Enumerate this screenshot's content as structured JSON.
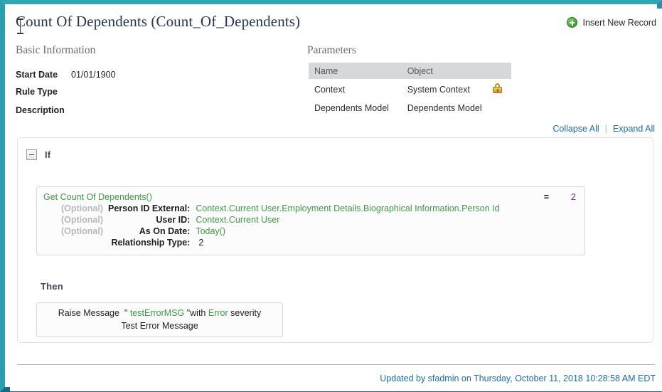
{
  "window": {
    "border_color": "#2aa0ae",
    "border_color_bottom": "#146b85"
  },
  "header": {
    "title": "Count Of Dependents (Count_Of_Dependents)",
    "insert_new_record_label": "Insert New Record",
    "insert_icon": "plus-circle-icon"
  },
  "basic_information": {
    "heading": "Basic Information",
    "fields": [
      {
        "label": "Start Date",
        "value": "01/01/1900"
      },
      {
        "label": "Rule Type",
        "value": ""
      },
      {
        "label": "Description",
        "value": ""
      }
    ]
  },
  "parameters": {
    "heading": "Parameters",
    "columns": [
      "Name",
      "Object"
    ],
    "rows": [
      {
        "name": "Context",
        "object": "System Context",
        "locked": true,
        "lock_icon": "lock-icon"
      },
      {
        "name": "Dependents Model",
        "object": "Dependents Model",
        "locked": false,
        "lock_icon": ""
      }
    ]
  },
  "tree_controls": {
    "collapse_all": "Collapse All",
    "expand_all": "Expand All",
    "separator": "|",
    "link_color": "#1b6ca8"
  },
  "rule": {
    "if_keyword": "If",
    "toggle_icon": "minus-box-icon",
    "condition": {
      "function_name": "Get Count Of Dependents()",
      "function_color": "#3f9a47",
      "arguments": [
        {
          "optional": "(Optional)",
          "label": "Person ID External:",
          "value": "Context.Current User.Employment Details.Biographical Information.Person Id",
          "value_style": "expression"
        },
        {
          "optional": "(Optional)",
          "label": "User ID:",
          "value": "Context.Current User",
          "value_style": "expression"
        },
        {
          "optional": "(Optional)",
          "label": "As On Date:",
          "value": "Today()",
          "value_style": "expression"
        },
        {
          "optional": "",
          "label": "Relationship Type:",
          "value": "2",
          "value_style": "literal"
        }
      ],
      "operator": "=",
      "right_operand": "2",
      "right_operand_color": "#7b2a8a"
    },
    "then_keyword": "Then",
    "action": {
      "verb": "Raise Message",
      "quote_open": "\"",
      "message_key": "testErrorMSG",
      "quote_close": "\"",
      "with_word": "with",
      "severity": "Error",
      "severity_word": "severity",
      "message_text": "Test Error Message"
    }
  },
  "footer": {
    "updated_text": "Updated by sfadmin on Thursday, October 11, 2018 10:28:58 AM EDT"
  }
}
